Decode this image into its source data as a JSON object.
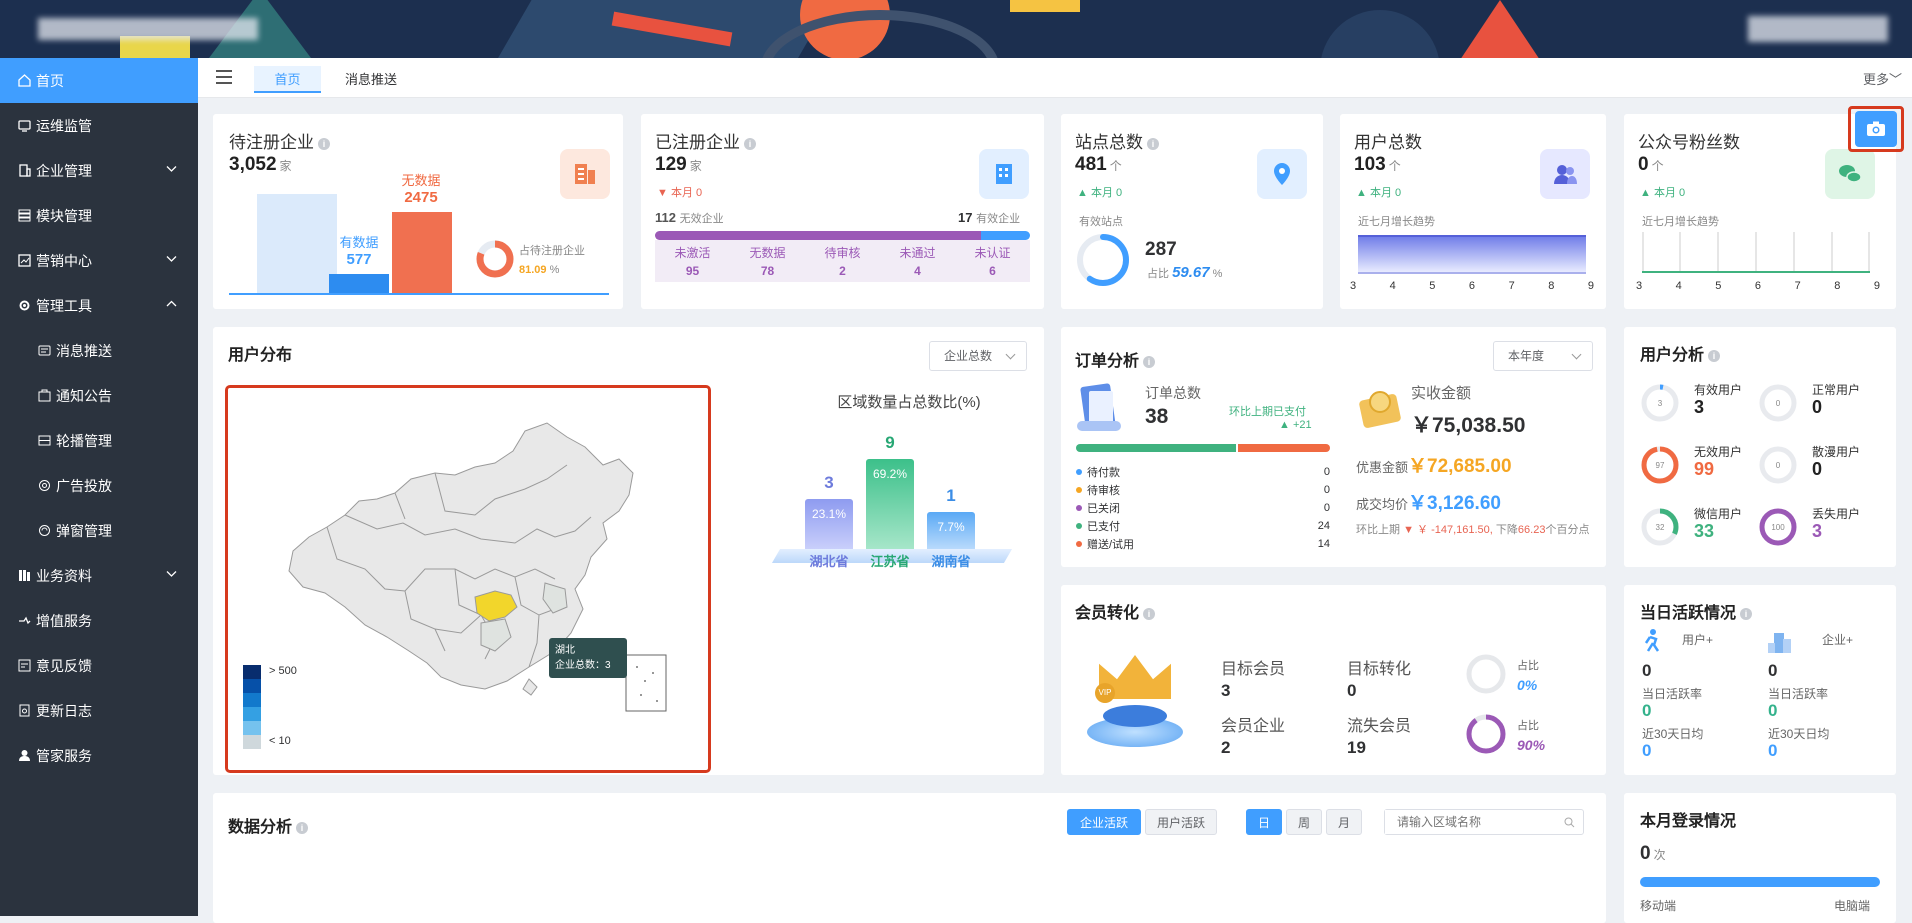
{
  "header": {
    "brand": "",
    "user": ""
  },
  "sidebar": {
    "items": [
      {
        "label": "首页",
        "icon": "home-icon",
        "active": true
      },
      {
        "label": "运维监管",
        "icon": "monitor-icon"
      },
      {
        "label": "企业管理",
        "icon": "building-icon",
        "expand": "down"
      },
      {
        "label": "模块管理",
        "icon": "module-icon"
      },
      {
        "label": "营销中心",
        "icon": "chart-icon",
        "expand": "down"
      },
      {
        "label": "管理工具",
        "icon": "tool-icon",
        "expand": "up"
      },
      {
        "label": "消息推送",
        "icon": "message-icon",
        "sub": true
      },
      {
        "label": "通知公告",
        "icon": "notice-icon",
        "sub": true
      },
      {
        "label": "轮播管理",
        "icon": "carousel-icon",
        "sub": true
      },
      {
        "label": "广告投放",
        "icon": "ad-icon",
        "sub": true
      },
      {
        "label": "弹窗管理",
        "icon": "popup-icon",
        "sub": true
      },
      {
        "label": "业务资料",
        "icon": "data-icon",
        "expand": "down"
      },
      {
        "label": "增值服务",
        "icon": "service-icon"
      },
      {
        "label": "意见反馈",
        "icon": "feedback-icon"
      },
      {
        "label": "更新日志",
        "icon": "log-icon"
      },
      {
        "label": "管家服务",
        "icon": "user-icon"
      }
    ]
  },
  "tabs": {
    "home": "首页",
    "push": "消息推送",
    "more": "更多"
  },
  "pending": {
    "title": "待注册企业",
    "value": "3,052",
    "unit": "家",
    "has_label": "有数据",
    "has_value": "577",
    "none_label": "无数据",
    "none_value": "2475",
    "ratio_label": "占待注册企业",
    "ratio": "81.09",
    "ratio_unit": "%"
  },
  "registered": {
    "title": "已注册企业",
    "value": "129",
    "unit": "家",
    "month": "本月 0",
    "invalid_num": "112",
    "invalid_label": "无效企业",
    "valid_num": "17",
    "valid_label": "有效企业",
    "stats": [
      {
        "label": "未激活",
        "value": "95"
      },
      {
        "label": "无数据",
        "value": "78"
      },
      {
        "label": "待审核",
        "value": "2"
      },
      {
        "label": "未通过",
        "value": "4"
      },
      {
        "label": "未认证",
        "value": "6"
      }
    ]
  },
  "sites": {
    "title": "站点总数",
    "value": "481",
    "unit": "个",
    "month": "本月 0",
    "valid_label": "有效站点",
    "valid_value": "287",
    "ratio_label": "占比",
    "ratio": "59.67",
    "ratio_unit": "%",
    "ratio_fill": 0.5967
  },
  "users": {
    "title": "用户总数",
    "value": "103",
    "unit": "个",
    "month": "本月 0",
    "trend": "近七月增长趋势",
    "ticks": [
      "3",
      "4",
      "5",
      "6",
      "7",
      "8",
      "9"
    ]
  },
  "fans": {
    "title": "公众号粉丝数",
    "value": "0",
    "unit": "个",
    "month": "本月 0",
    "trend": "近七月增长趋势",
    "ticks": [
      "3",
      "4",
      "5",
      "6",
      "7",
      "8",
      "9"
    ]
  },
  "dist": {
    "title": "用户分布",
    "select": "企业总数",
    "chart_title": "区域数量占总数比(%)",
    "legend_hi": "> 500",
    "legend_lo": "< 10",
    "tooltip_region": "湖北",
    "tooltip_label": "企业总数：3",
    "bars": [
      {
        "name": "湖北省",
        "value": "3",
        "pct": "23.1%"
      },
      {
        "name": "江苏省",
        "value": "9",
        "pct": "69.2%"
      },
      {
        "name": "湖南省",
        "value": "1",
        "pct": "7.7%"
      }
    ]
  },
  "orders": {
    "title": "订单分析",
    "select": "本年度",
    "total_label": "订单总数",
    "total": "38",
    "cmp_label": "环比上期已支付",
    "cmp_val": "+21",
    "items": [
      {
        "label": "待付款",
        "value": "0",
        "color": "#409eff"
      },
      {
        "label": "待审核",
        "value": "0",
        "color": "#f5a623"
      },
      {
        "label": "已关闭",
        "value": "0",
        "color": "#9b59b6"
      },
      {
        "label": "已支付",
        "value": "24",
        "color": "#3fb27f"
      },
      {
        "label": "赠送/试用",
        "value": "14",
        "color": "#f06a42"
      }
    ],
    "income_label": "实收金额",
    "income": "￥75,038.50",
    "discount_label": "优惠金额",
    "discount": "￥72,685.00",
    "avg_label": "成交均价",
    "avg": "￥3,126.60",
    "last_label": "环比上期",
    "last_val": "￥ -147,161.50,",
    "drop_label": "下降",
    "drop_val": "66.23",
    "drop_unit": "个百分点"
  },
  "ua": {
    "title": "用户分析",
    "items": [
      {
        "label": "有效用户",
        "value": "3",
        "ring": "3",
        "color": "#409eff"
      },
      {
        "label": "正常用户",
        "value": "0",
        "ring": "0",
        "color": "#c0c4cc"
      },
      {
        "label": "无效用户",
        "value": "99",
        "ring": "97",
        "color": "#f06a42"
      },
      {
        "label": "散漫用户",
        "value": "0",
        "ring": "0",
        "color": "#c0c4cc"
      },
      {
        "label": "微信用户",
        "value": "33",
        "ring": "32",
        "color": "#3fb27f"
      },
      {
        "label": "丢失用户",
        "value": "3",
        "ring": "100",
        "color": "#9b59b6"
      }
    ]
  },
  "member": {
    "title": "会员转化",
    "target": "目标会员",
    "target_v": "3",
    "conv": "目标转化",
    "conv_v": "0",
    "ent": "会员企业",
    "ent_v": "2",
    "lost": "流失会员",
    "lost_v": "19",
    "r1_label": "占比",
    "r1": "0%",
    "r2_label": "占比",
    "r2": "90%"
  },
  "active": {
    "title": "当日活跃情况",
    "u_label": "用户+",
    "u_v": "0",
    "u_rate": "当日活跃率",
    "u_rate_v": "0",
    "u_avg": "近30天日均",
    "u_avg_v": "0",
    "e_label": "企业+",
    "e_v": "0",
    "e_rate": "当日活跃率",
    "e_rate_v": "0",
    "e_avg": "近30天日均",
    "e_avg_v": "0"
  },
  "analysis": {
    "title": "数据分析",
    "b1": "企业活跃",
    "b2": "用户活跃",
    "d": "日",
    "w": "周",
    "m": "月",
    "placeholder": "请输入区域名称"
  },
  "login": {
    "title": "本月登录情况",
    "value": "0",
    "unit": "次",
    "mobile": "移动端",
    "pc": "电脑端"
  }
}
